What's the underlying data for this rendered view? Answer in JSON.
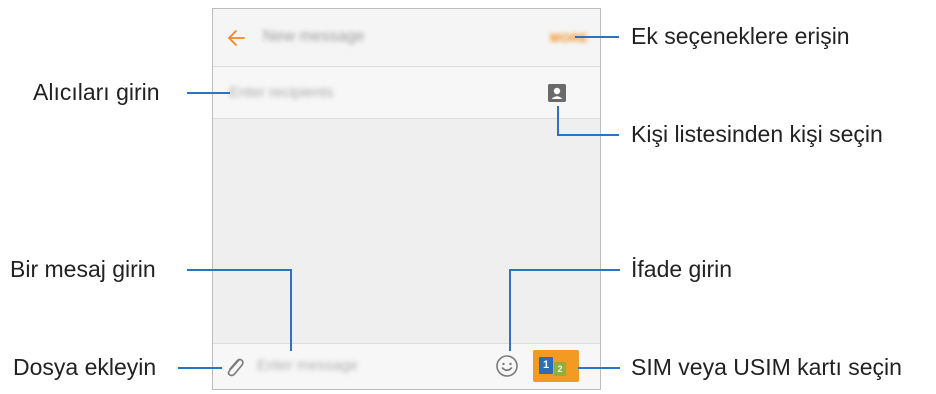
{
  "phone": {
    "app_title": "New message",
    "more_label": "MORE",
    "recipients_placeholder": "Enter recipients",
    "message_placeholder": "Enter message",
    "sim1_label": "1",
    "sim2_label": "2"
  },
  "callouts": {
    "more_options": "Ek seçeneklere erişin",
    "enter_recipients": "Alıcıları girin",
    "select_contact": "Kişi listesinden kişi seçin",
    "enter_message": "Bir mesaj girin",
    "enter_emoticon": "İfade girin",
    "attach_file": "Dosya ekleyin",
    "select_sim": "SIM veya USIM kartı seçin"
  },
  "colors": {
    "accent": "#f08a1c",
    "callout_line": "#2a74c8",
    "sim1": "#2a6fb5",
    "sim2": "#8fae3a"
  }
}
